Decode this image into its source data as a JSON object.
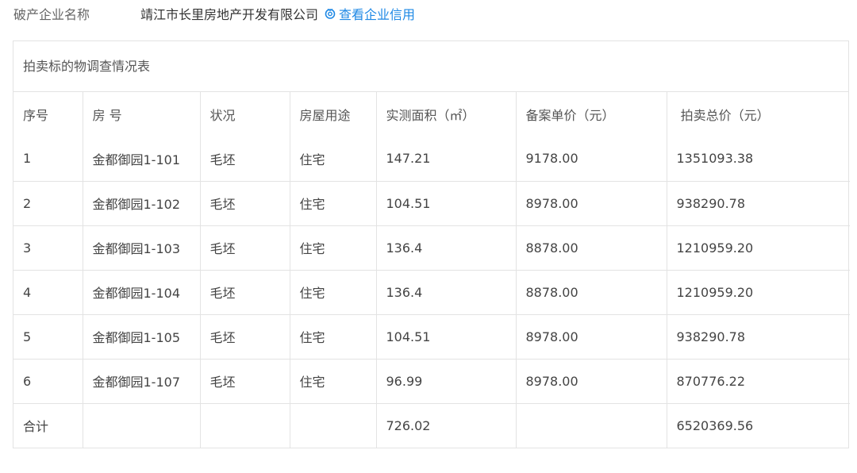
{
  "company": {
    "label": "破产企业名称",
    "name": "靖江市长里房地产开发有限公司",
    "credit_link": "查看企业信用",
    "link_color": "#1e88e5"
  },
  "table": {
    "title": "拍卖标的物调查情况表",
    "headers": [
      "序号",
      "房 号",
      "状况",
      "房屋用途",
      "实测面积（㎡）",
      "备案单价（元）",
      " 拍卖总价（元）"
    ],
    "rows": [
      [
        "1",
        "金都御园1-101",
        "毛坯",
        "住宅",
        "147.21",
        "9178.00",
        "1351093.38"
      ],
      [
        "2",
        "金都御园1-102",
        "毛坯",
        "住宅",
        "104.51",
        "8978.00",
        "938290.78"
      ],
      [
        "3",
        "金都御园1-103",
        "毛坯",
        "住宅",
        "136.4",
        "8878.00",
        "1210959.20"
      ],
      [
        "4",
        "金都御园1-104",
        "毛坯",
        "住宅",
        "136.4",
        "8878.00",
        "1210959.20"
      ],
      [
        "5",
        "金都御园1-105",
        "毛坯",
        "住宅",
        "104.51",
        "8978.00",
        "938290.78"
      ],
      [
        "6",
        "金都御园1-107",
        "毛坯",
        "住宅",
        "96.99",
        "8978.00",
        "870776.22"
      ]
    ],
    "total": [
      "合计",
      "",
      "",
      "",
      "726.02",
      "",
      "6520369.56"
    ]
  }
}
